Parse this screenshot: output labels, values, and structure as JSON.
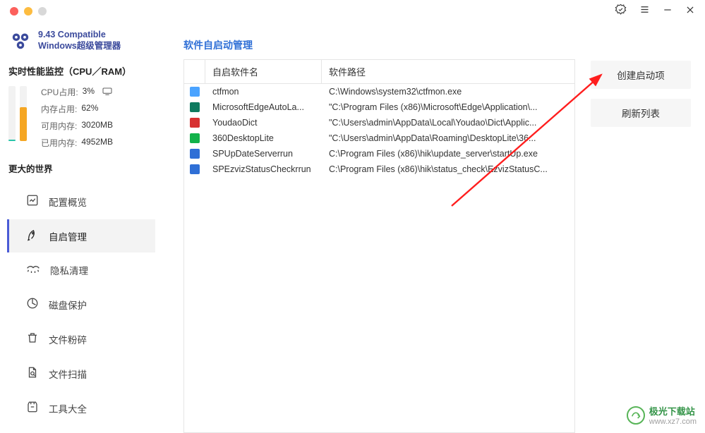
{
  "brand": {
    "line1": "9.43 Compatible",
    "line2": "Windows超级管理器"
  },
  "perf_title": "实时性能监控（CPU／RAM）",
  "perf": {
    "cpu_label": "CPU占用:",
    "cpu_value": "3%",
    "cpu_pct": 3,
    "ram_label": "内存占用:",
    "ram_value": "62%",
    "ram_pct": 62,
    "free_label": "可用内存:",
    "free_value": "3020MB",
    "used_label": "已用内存:",
    "used_value": "4952MB",
    "cpu_color": "#29c4a9",
    "ram_color": "#f5a623"
  },
  "world_title": "更大的世界",
  "nav": [
    {
      "key": "overview",
      "label": "配置概览"
    },
    {
      "key": "startup",
      "label": "自启管理"
    },
    {
      "key": "privacy",
      "label": "隐私清理"
    },
    {
      "key": "disk",
      "label": "磁盘保护"
    },
    {
      "key": "shred",
      "label": "文件粉碎"
    },
    {
      "key": "scan",
      "label": "文件扫描"
    },
    {
      "key": "tools",
      "label": "工具大全"
    }
  ],
  "nav_active": "startup",
  "page_title": "软件自启动管理",
  "table": {
    "headers": {
      "name": "自启软件名",
      "path": "软件路径"
    },
    "rows": [
      {
        "icon_bg": "#4aa3ff",
        "name": "ctfmon",
        "path": "C:\\Windows\\system32\\ctfmon.exe"
      },
      {
        "icon_bg": "#0e7a5f",
        "name": "MicrosoftEdgeAutoLa...",
        "path": "\"C:\\Program Files (x86)\\Microsoft\\Edge\\Application\\..."
      },
      {
        "icon_bg": "#d73131",
        "name": "YoudaoDict",
        "path": "\"C:\\Users\\admin\\AppData\\Local\\Youdao\\Dict\\Applic..."
      },
      {
        "icon_bg": "#12b24a",
        "name": "360DesktopLite",
        "path": "\"C:\\Users\\admin\\AppData\\Roaming\\DesktopLite\\36..."
      },
      {
        "icon_bg": "#2f6fd6",
        "name": "SPUpDateServerrun",
        "path": "C:\\Program Files (x86)\\hik\\update_server\\startUp.exe"
      },
      {
        "icon_bg": "#2f6fd6",
        "name": "SPEzvizStatusCheckrrun",
        "path": "C:\\Program Files (x86)\\hik\\status_check\\EzvizStatusC..."
      }
    ]
  },
  "actions": {
    "create": "创建启动项",
    "refresh": "刷新列表"
  },
  "watermark": {
    "name": "极光下载站",
    "url": "www.xz7.com"
  }
}
